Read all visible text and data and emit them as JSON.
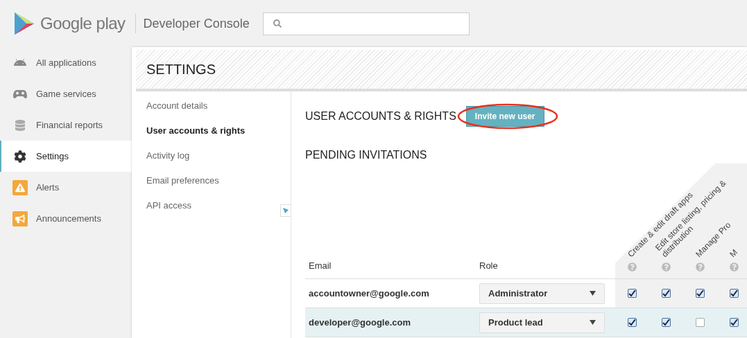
{
  "header": {
    "brand": "Google play",
    "product": "Developer Console"
  },
  "nav": [
    {
      "label": "All applications",
      "selected": false
    },
    {
      "label": "Game services",
      "selected": false
    },
    {
      "label": "Financial reports",
      "selected": false
    },
    {
      "label": "Settings",
      "selected": true
    },
    {
      "label": "Alerts",
      "selected": false
    },
    {
      "label": "Announcements",
      "selected": false
    }
  ],
  "page_title": "SETTINGS",
  "subnav": [
    {
      "label": "Account details",
      "selected": false
    },
    {
      "label": "User accounts & rights",
      "selected": true
    },
    {
      "label": "Activity log",
      "selected": false
    },
    {
      "label": "Email preferences",
      "selected": false
    },
    {
      "label": "API access",
      "selected": false
    }
  ],
  "section_title": "USER ACCOUNTS & RIGHTS",
  "invite_button": "Invite new user",
  "pending_title": "PENDING INVITATIONS",
  "table": {
    "columns": [
      "Email",
      "Role"
    ],
    "permissions": [
      "Create & edit draft apps",
      "Edit store listing, pricing & distribution",
      "Manage Pro",
      "M"
    ],
    "rows": [
      {
        "email": "accountowner@google.com",
        "role": "Administrator",
        "highlighted": false,
        "permissions": [
          true,
          true,
          true,
          true
        ]
      },
      {
        "email": "developer@google.com",
        "role": "Product lead",
        "highlighted": true,
        "permissions": [
          true,
          true,
          false,
          true
        ]
      }
    ]
  }
}
